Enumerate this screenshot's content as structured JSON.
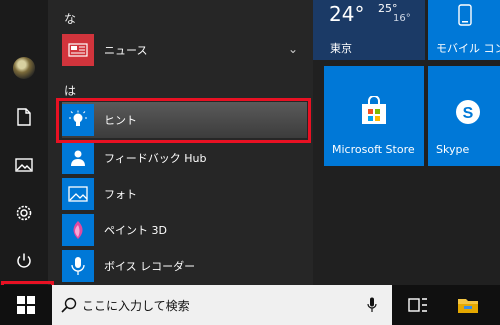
{
  "app_list": {
    "letters": [
      "な",
      "は"
    ],
    "items": [
      {
        "label": "ニュース",
        "color": "#d1343c"
      },
      {
        "label": "ヒント",
        "color": "#0078d7"
      },
      {
        "label": "フィードバック Hub",
        "color": "#0078d7"
      },
      {
        "label": "フォト",
        "color": "#0078d7"
      },
      {
        "label": "ペイント 3D",
        "color": "#0078d7"
      },
      {
        "label": "ボイス レコーダー",
        "color": "#0078d7"
      }
    ]
  },
  "tiles": {
    "weather": {
      "temp": "24°",
      "high": "25°",
      "low": "16°",
      "city": "東京"
    },
    "mobile": {
      "label": "モバイル コン"
    },
    "store": {
      "label": "Microsoft Store"
    },
    "skype": {
      "label": "Skype"
    }
  },
  "taskbar": {
    "search_placeholder": "ここに入力して検索"
  },
  "icons": {
    "rail": [
      "avatar",
      "document-icon",
      "pictures-icon",
      "settings-icon",
      "power-icon"
    ],
    "taskbar": [
      "windows-logo-icon",
      "search-icon",
      "microphone-icon",
      "task-view-icon",
      "file-explorer-icon"
    ]
  },
  "colors": {
    "accent": "#0078d7",
    "highlight_box": "#e81123",
    "news_tile": "#d1343c"
  }
}
